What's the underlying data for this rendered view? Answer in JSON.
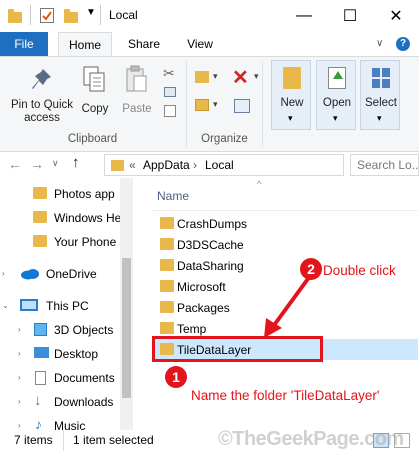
{
  "window": {
    "title": "Local",
    "minimize_glyph": "—",
    "maximize_glyph": "☐",
    "close_glyph": "✕"
  },
  "ribbon_tabs": [
    "File",
    "Home",
    "Share",
    "View"
  ],
  "ribbon": {
    "pin_label": "Pin to Quick access",
    "copy_label": "Copy",
    "paste_label": "Paste",
    "clipboard_group": "Clipboard",
    "organize_group": "Organize",
    "new_label": "New",
    "open_label": "Open",
    "select_label": "Select"
  },
  "address": {
    "crumb_prefix": "«",
    "crumbs": [
      "AppData",
      "Local"
    ],
    "search_placeholder": "Search Lo..."
  },
  "nav_pane": {
    "items": [
      {
        "label": "Photos app",
        "icon": "folder-icon"
      },
      {
        "label": "Windows He",
        "icon": "folder-icon"
      },
      {
        "label": "Your Phone",
        "icon": "folder-icon"
      },
      {
        "label": "OneDrive",
        "icon": "onedrive-icon"
      },
      {
        "label": "This PC",
        "icon": "pc-icon"
      },
      {
        "label": "3D Objects",
        "icon": "3d-objects-icon"
      },
      {
        "label": "Desktop",
        "icon": "desktop-icon"
      },
      {
        "label": "Documents",
        "icon": "documents-icon"
      },
      {
        "label": "Downloads",
        "icon": "downloads-icon"
      },
      {
        "label": "Music",
        "icon": "music-icon"
      }
    ]
  },
  "content": {
    "column_name": "Name",
    "files": [
      "CrashDumps",
      "D3DSCache",
      "DataSharing",
      "Microsoft",
      "Packages",
      "Temp",
      "TileDataLayer"
    ],
    "selected": "TileDataLayer"
  },
  "annotations": {
    "step1_number": "1",
    "step1_text": "Name the folder 'TileDataLayer'",
    "step2_number": "2",
    "step2_text": "Double click",
    "color": "#e3141b"
  },
  "status": {
    "items_count": "7 items",
    "selected_count": "1 item selected"
  },
  "watermark": "©TheGeekPage.com",
  "colors": {
    "file_tab": "#1f6fc1",
    "selection": "#cce8ff",
    "folder": "#e8b84a"
  }
}
